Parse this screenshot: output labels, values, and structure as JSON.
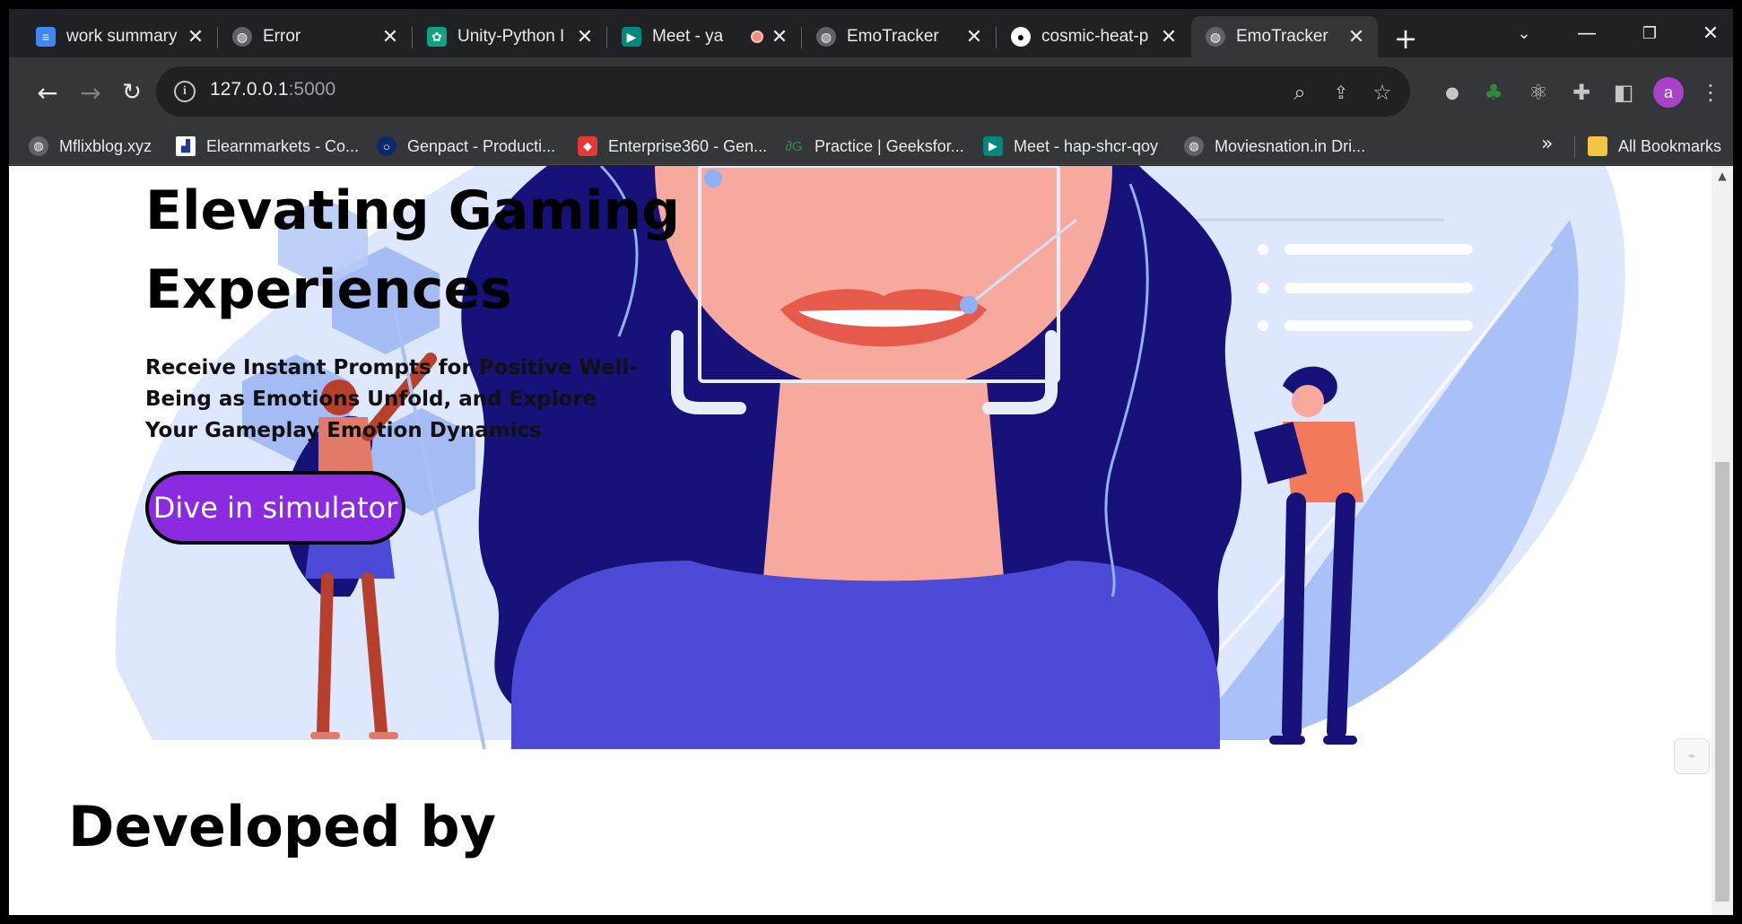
{
  "browser": {
    "tabs": [
      {
        "title": "work summary",
        "icon": "google-docs-icon",
        "color": "#4285f4"
      },
      {
        "title": "Error",
        "icon": "globe-icon",
        "color": "#9aa0a6"
      },
      {
        "title": "Unity-Python I",
        "icon": "chatgpt-icon",
        "color": "#10a37f"
      },
      {
        "title": "Meet - ya",
        "icon": "google-meet-icon",
        "color": "#00897b",
        "recording": true
      },
      {
        "title": "EmoTracker",
        "icon": "globe-icon",
        "color": "#9aa0a6"
      },
      {
        "title": "cosmic-heat-p",
        "icon": "github-icon",
        "color": "#ffffff"
      },
      {
        "title": "EmoTracker",
        "icon": "globe-icon",
        "color": "#9aa0a6",
        "active": true
      }
    ],
    "address": {
      "host": "127.0.0.1",
      "port": ":5000"
    },
    "bookmarks": [
      {
        "label": "Mflixblog.xyz",
        "icon": "globe-icon"
      },
      {
        "label": "Elearnmarkets - Co...",
        "icon": "chart-icon"
      },
      {
        "label": "Genpact - Producti...",
        "icon": "genpact-icon"
      },
      {
        "label": "Enterprise360 - Gen...",
        "icon": "enterprise360-icon"
      },
      {
        "label": "Practice | Geeksfor...",
        "icon": "geeksforgeeks-icon"
      },
      {
        "label": "Meet - hap-shcr-qoy",
        "icon": "google-meet-icon"
      },
      {
        "label": "Moviesnation.in Dri...",
        "icon": "globe-icon"
      }
    ],
    "bookmarks_more": "»",
    "all_bookmarks": "All Bookmarks",
    "profile_initial": "a"
  },
  "page": {
    "hero": {
      "title": "Elevating Gaming Experiences",
      "subtitle": "Receive Instant Prompts for Positive Well-Being as Emotions Unfold, and Explore Your Gameplay Emotion Dynamics",
      "cta_label": "Dive in simulator"
    },
    "developed_by": "Developed by"
  },
  "colors": {
    "cta": "#8a2be2",
    "illustration_navy": "#16127a",
    "illustration_blue": "#4d4ad8",
    "illustration_light": "#c9d8fb",
    "skin": "#f7a99d"
  }
}
